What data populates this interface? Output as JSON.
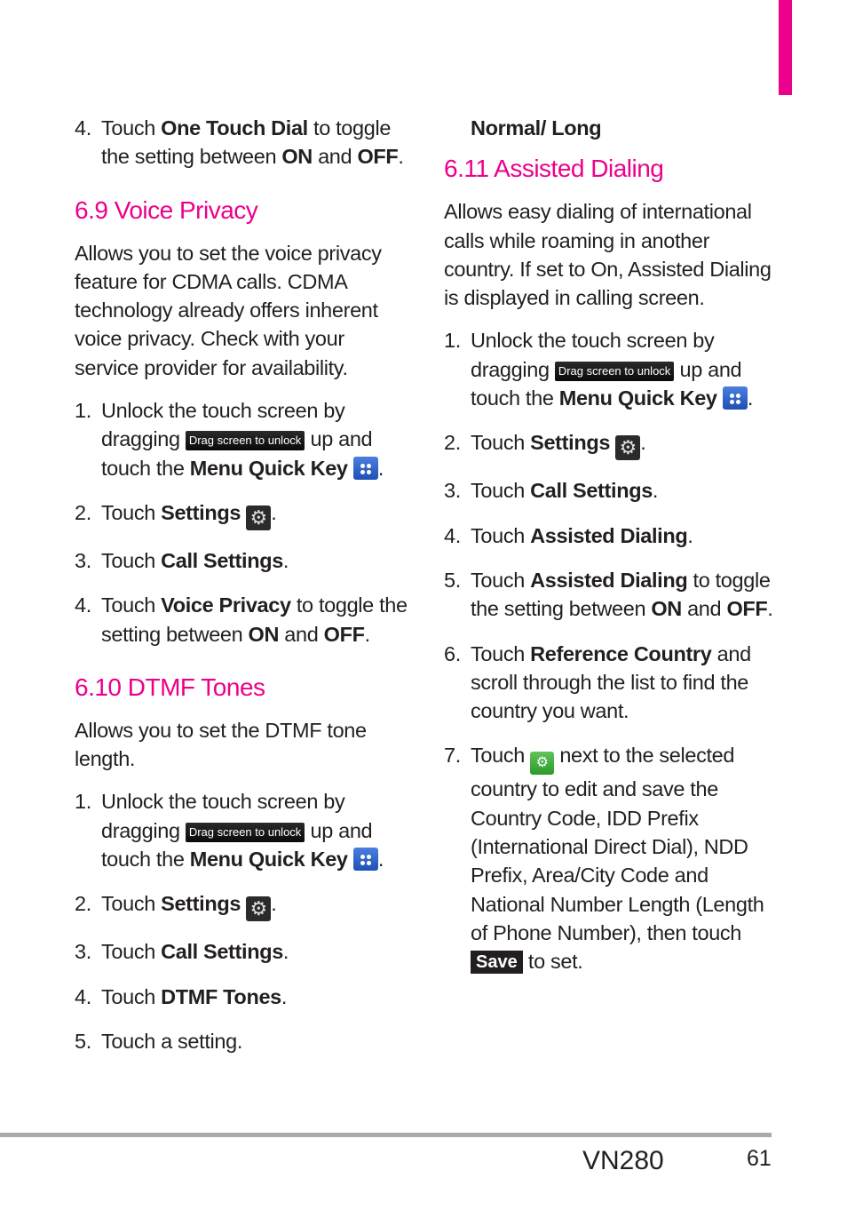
{
  "accent_color": "#ec008c",
  "left": {
    "intro_step": {
      "num": "4.",
      "pre": "Touch ",
      "bold": "One Touch Dial",
      "post": " to toggle the setting between ",
      "on": "ON",
      "and": " and ",
      "off": "OFF",
      "end": "."
    },
    "voice_privacy": {
      "heading": "6.9 Voice Privacy",
      "description": "Allows you to set the voice privacy feature for CDMA calls. CDMA technology already offers inherent voice privacy. Check with your service provider for availability.",
      "step1": {
        "num": "1.",
        "pre": "Unlock the touch screen by dragging ",
        "pill": "Drag screen to unlock",
        "mid": " up and touch the ",
        "bold": "Menu Quick Key",
        "end": "."
      },
      "step2": {
        "num": "2.",
        "pre": "Touch ",
        "bold": "Settings",
        "end": "."
      },
      "step3": {
        "num": "3.",
        "pre": "Touch ",
        "bold": "Call Settings",
        "end": "."
      },
      "step4": {
        "num": "4.",
        "pre": "Touch ",
        "bold": "Voice Privacy",
        "post": " to toggle the setting between ",
        "on": "ON",
        "and": " and ",
        "off": "OFF",
        "end": "."
      }
    },
    "dtmf": {
      "heading": "6.10 DTMF Tones",
      "description": "Allows you to set the DTMF tone length.",
      "step1": {
        "num": "1.",
        "pre": "Unlock the touch screen by dragging ",
        "pill": "Drag screen to unlock",
        "mid": " up and touch the ",
        "bold": "Menu Quick Key",
        "end": "."
      },
      "step2": {
        "num": "2.",
        "pre": "Touch ",
        "bold": "Settings",
        "end": "."
      },
      "step3": {
        "num": "3.",
        "pre": "Touch ",
        "bold": "Call Settings",
        "end": "."
      },
      "step4": {
        "num": "4.",
        "pre": "Touch ",
        "bold": "DTMF Tones",
        "end": "."
      },
      "step5": {
        "num": "5.",
        "text": "Touch a setting."
      }
    }
  },
  "right": {
    "continued": "Normal/ Long",
    "assisted": {
      "heading": "6.11 Assisted Dialing",
      "description": "Allows easy dialing of international calls while roaming in another country. If set to On, Assisted Dialing is displayed in calling screen.",
      "step1": {
        "num": "1.",
        "pre": "Unlock the touch screen by dragging ",
        "pill": "Drag screen to unlock",
        "mid": " up and touch the ",
        "bold": "Menu Quick Key",
        "end": "."
      },
      "step2": {
        "num": "2.",
        "pre": "Touch ",
        "bold": "Settings",
        "end": "."
      },
      "step3": {
        "num": "3.",
        "pre": "Touch ",
        "bold": "Call Settings",
        "end": "."
      },
      "step4": {
        "num": "4.",
        "pre": "Touch ",
        "bold": "Assisted Dialing",
        "end": "."
      },
      "step5": {
        "num": "5.",
        "pre": "Touch ",
        "bold": "Assisted Dialing",
        "post": " to toggle the setting between ",
        "on": "ON",
        "and": " and ",
        "off": "OFF",
        "end": "."
      },
      "step6": {
        "num": "6.",
        "pre": "Touch ",
        "bold": "Reference Country",
        "post": " and scroll through the list to find the country you want."
      },
      "step7": {
        "num": "7.",
        "pre": "Touch ",
        "post": " next to the selected country to edit and save the Country Code, IDD Prefix (International Direct Dial), NDD Prefix, Area/City Code and National Number Length (Length of Phone Number), then touch ",
        "save": "Save",
        "end": " to set."
      }
    }
  },
  "footer": {
    "model": "VN280",
    "page": "61"
  }
}
